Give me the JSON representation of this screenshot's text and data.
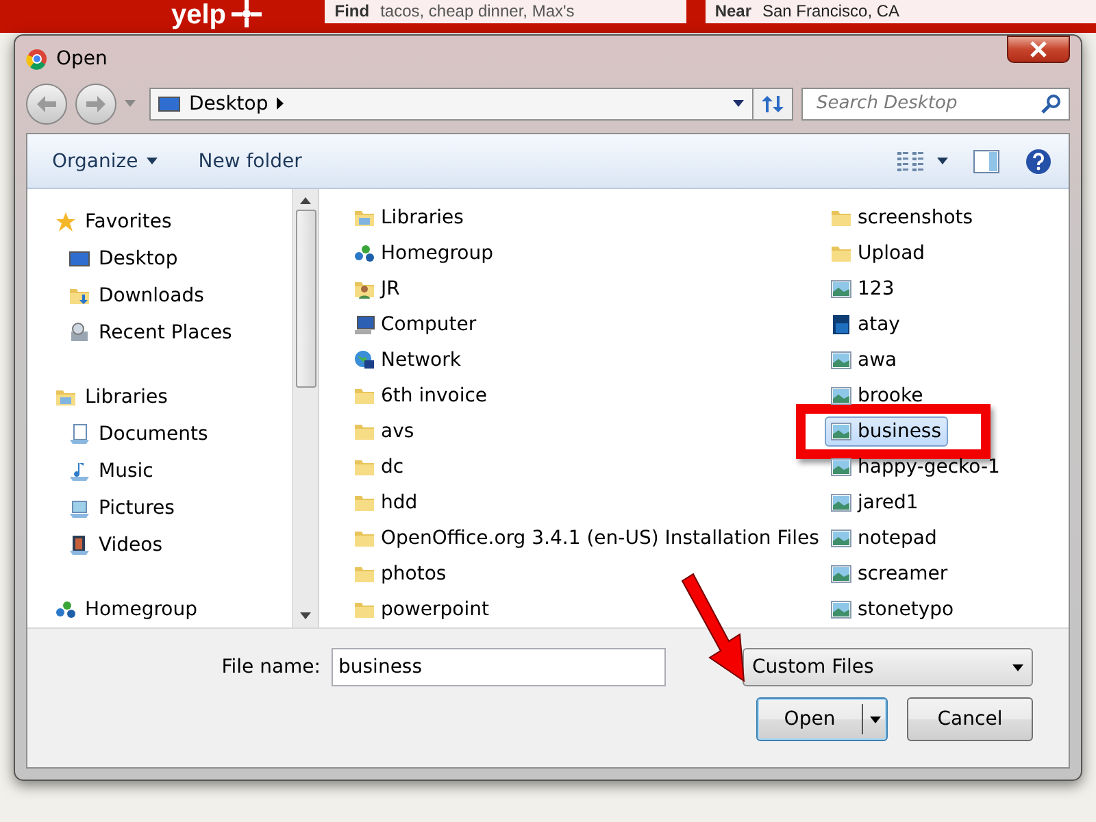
{
  "site_header": {
    "logo": "yelp",
    "find": {
      "label": "Find",
      "placeholder": "tacos, cheap dinner, Max's"
    },
    "near": {
      "label": "Near",
      "value": "San Francisco, CA"
    }
  },
  "window": {
    "title": "Open"
  },
  "address_bar": {
    "crumbs": [
      "Desktop"
    ],
    "search": {
      "placeholder": "Search Desktop"
    }
  },
  "toolbar": {
    "buttons": [
      {
        "label": "Organize",
        "dropdown": true
      },
      {
        "label": "New folder",
        "dropdown": false
      }
    ]
  },
  "sidebar": {
    "groups": [
      {
        "label": "Favorites",
        "kind": "star",
        "children": [
          {
            "label": "Desktop",
            "kind": "desktop"
          },
          {
            "label": "Downloads",
            "kind": "downloads"
          },
          {
            "label": "Recent Places",
            "kind": "recent"
          }
        ]
      },
      {
        "label": "Libraries",
        "kind": "library",
        "children": [
          {
            "label": "Documents",
            "kind": "documents"
          },
          {
            "label": "Music",
            "kind": "music"
          },
          {
            "label": "Pictures",
            "kind": "pictures"
          },
          {
            "label": "Videos",
            "kind": "videos"
          }
        ]
      },
      {
        "label": "Homegroup",
        "kind": "homegroup"
      }
    ]
  },
  "files": [
    {
      "name": "Libraries",
      "kind": "library",
      "selected": false
    },
    {
      "name": "Homegroup",
      "kind": "homegroup",
      "selected": false
    },
    {
      "name": "JR",
      "kind": "user",
      "selected": false
    },
    {
      "name": "Computer",
      "kind": "computer",
      "selected": false
    },
    {
      "name": "Network",
      "kind": "network",
      "selected": false
    },
    {
      "name": "6th invoice",
      "kind": "folder",
      "selected": false
    },
    {
      "name": "avs",
      "kind": "folder",
      "selected": false
    },
    {
      "name": "dc",
      "kind": "folder",
      "selected": false
    },
    {
      "name": "hdd",
      "kind": "folder",
      "selected": false
    },
    {
      "name": "OpenOffice.org 3.4.1 (en-US) Installation Files",
      "kind": "folder",
      "selected": false
    },
    {
      "name": "photos",
      "kind": "folder",
      "selected": false
    },
    {
      "name": "powerpoint",
      "kind": "folder",
      "selected": false
    },
    {
      "name": "screenshots",
      "kind": "folder",
      "selected": false
    },
    {
      "name": "Upload",
      "kind": "folder",
      "selected": false
    },
    {
      "name": "123",
      "kind": "image",
      "selected": false
    },
    {
      "name": "atay",
      "kind": "psd",
      "selected": false
    },
    {
      "name": "awa",
      "kind": "image",
      "selected": false
    },
    {
      "name": "brooke",
      "kind": "image",
      "selected": false
    },
    {
      "name": "business",
      "kind": "image",
      "selected": true
    },
    {
      "name": "happy-gecko-1",
      "kind": "image",
      "selected": false
    },
    {
      "name": "jared1",
      "kind": "image",
      "selected": false
    },
    {
      "name": "notepad",
      "kind": "image",
      "selected": false
    },
    {
      "name": "screamer",
      "kind": "image",
      "selected": false
    },
    {
      "name": "stonetypo",
      "kind": "image",
      "selected": false
    }
  ],
  "footer": {
    "file_name_label": "File name:",
    "file_name": "business",
    "file_type": "Custom Files",
    "buttons": [
      {
        "label": "Open",
        "kind": "split"
      },
      {
        "label": "Cancel",
        "kind": "plain"
      }
    ]
  }
}
